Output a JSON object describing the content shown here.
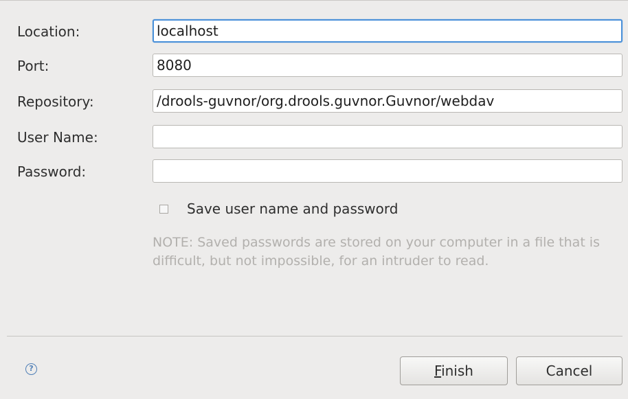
{
  "form": {
    "location": {
      "label": "Location:",
      "value": "localhost"
    },
    "port": {
      "label": "Port:",
      "value": "8080"
    },
    "repository": {
      "label": "Repository:",
      "value": "/drools-guvnor/org.drools.guvnor.Guvnor/webdav"
    },
    "username": {
      "label": "User Name:",
      "value": ""
    },
    "password": {
      "label": "Password:",
      "value": ""
    }
  },
  "save_credentials": {
    "label": "Save user name and password",
    "checked": false
  },
  "note": "NOTE: Saved passwords are stored on your computer in a file that is difficult, but not impossible, for an intruder to read.",
  "buttons": {
    "finish_mnemonic": "F",
    "finish_rest": "inish",
    "cancel": "Cancel"
  },
  "help_icon": {
    "icon": "help-icon",
    "glyph": "?"
  },
  "colors": {
    "focus": "#4a90d9",
    "note": "#b2b0ad",
    "background": "#edeceb"
  }
}
